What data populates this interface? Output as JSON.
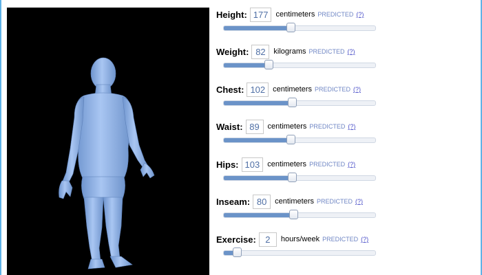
{
  "model": {
    "figure_color": "#93b7ea",
    "background": "#000000"
  },
  "sliders": [
    {
      "id": "height",
      "label": "Height:",
      "value": "177",
      "unit": "centimeters",
      "predicted": "PREDICTED",
      "help": "(?)",
      "level": 0.44
    },
    {
      "id": "weight",
      "label": "Weight:",
      "value": "82",
      "unit": "kilograms",
      "predicted": "PREDICTED",
      "help": "(?)",
      "level": 0.295
    },
    {
      "id": "chest",
      "label": "Chest:",
      "value": "102",
      "unit": "centimeters",
      "predicted": "PREDICTED",
      "help": "(?)",
      "level": 0.45
    },
    {
      "id": "waist",
      "label": "Waist:",
      "value": "89",
      "unit": "centimeters",
      "predicted": "PREDICTED",
      "help": "(?)",
      "level": 0.44
    },
    {
      "id": "hips",
      "label": "Hips:",
      "value": "103",
      "unit": "centimeters",
      "predicted": "PREDICTED",
      "help": "(?)",
      "level": 0.45
    },
    {
      "id": "inseam",
      "label": "Inseam:",
      "value": "80",
      "unit": "centimeters",
      "predicted": "PREDICTED",
      "help": "(?)",
      "level": 0.46
    },
    {
      "id": "exercise",
      "label": "Exercise:",
      "value": "2",
      "unit": "hours/week",
      "predicted": "PREDICTED",
      "help": "(?)",
      "level": 0.085
    }
  ]
}
